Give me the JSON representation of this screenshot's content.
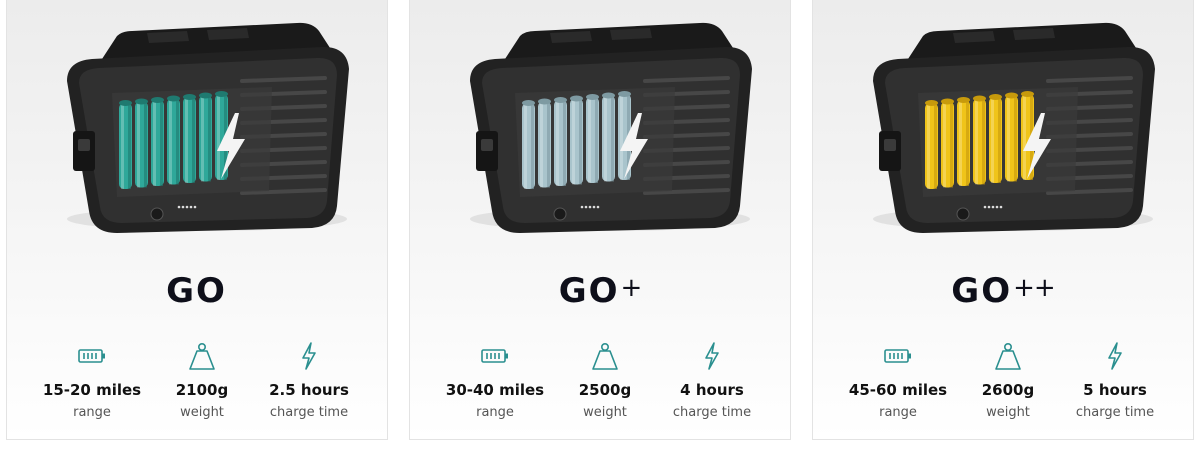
{
  "accent": "#2a8f8f",
  "products": [
    {
      "name": "GO",
      "suffix": "",
      "cell_color": "#2fa89a",
      "cell_dark": "#1f7a70",
      "specs": [
        {
          "value": "15-20 miles",
          "label": "range",
          "icon": "battery-icon"
        },
        {
          "value": "2100g",
          "label": "weight",
          "icon": "weight-icon"
        },
        {
          "value": "2.5 hours",
          "label": "charge time",
          "icon": "lightning-icon"
        }
      ]
    },
    {
      "name": "GO",
      "suffix": "+",
      "cell_color": "#a9c4cc",
      "cell_dark": "#7e9aa2",
      "specs": [
        {
          "value": "30-40 miles",
          "label": "range",
          "icon": "battery-icon"
        },
        {
          "value": "2500g",
          "label": "weight",
          "icon": "weight-icon"
        },
        {
          "value": "4 hours",
          "label": "charge time",
          "icon": "lightning-icon"
        }
      ]
    },
    {
      "name": "GO",
      "suffix": "++",
      "cell_color": "#f0c419",
      "cell_dark": "#c79a0c",
      "specs": [
        {
          "value": "45-60 miles",
          "label": "range",
          "icon": "battery-icon"
        },
        {
          "value": "2600g",
          "label": "weight",
          "icon": "weight-icon"
        },
        {
          "value": "5 hours",
          "label": "charge time",
          "icon": "lightning-icon"
        }
      ]
    }
  ]
}
